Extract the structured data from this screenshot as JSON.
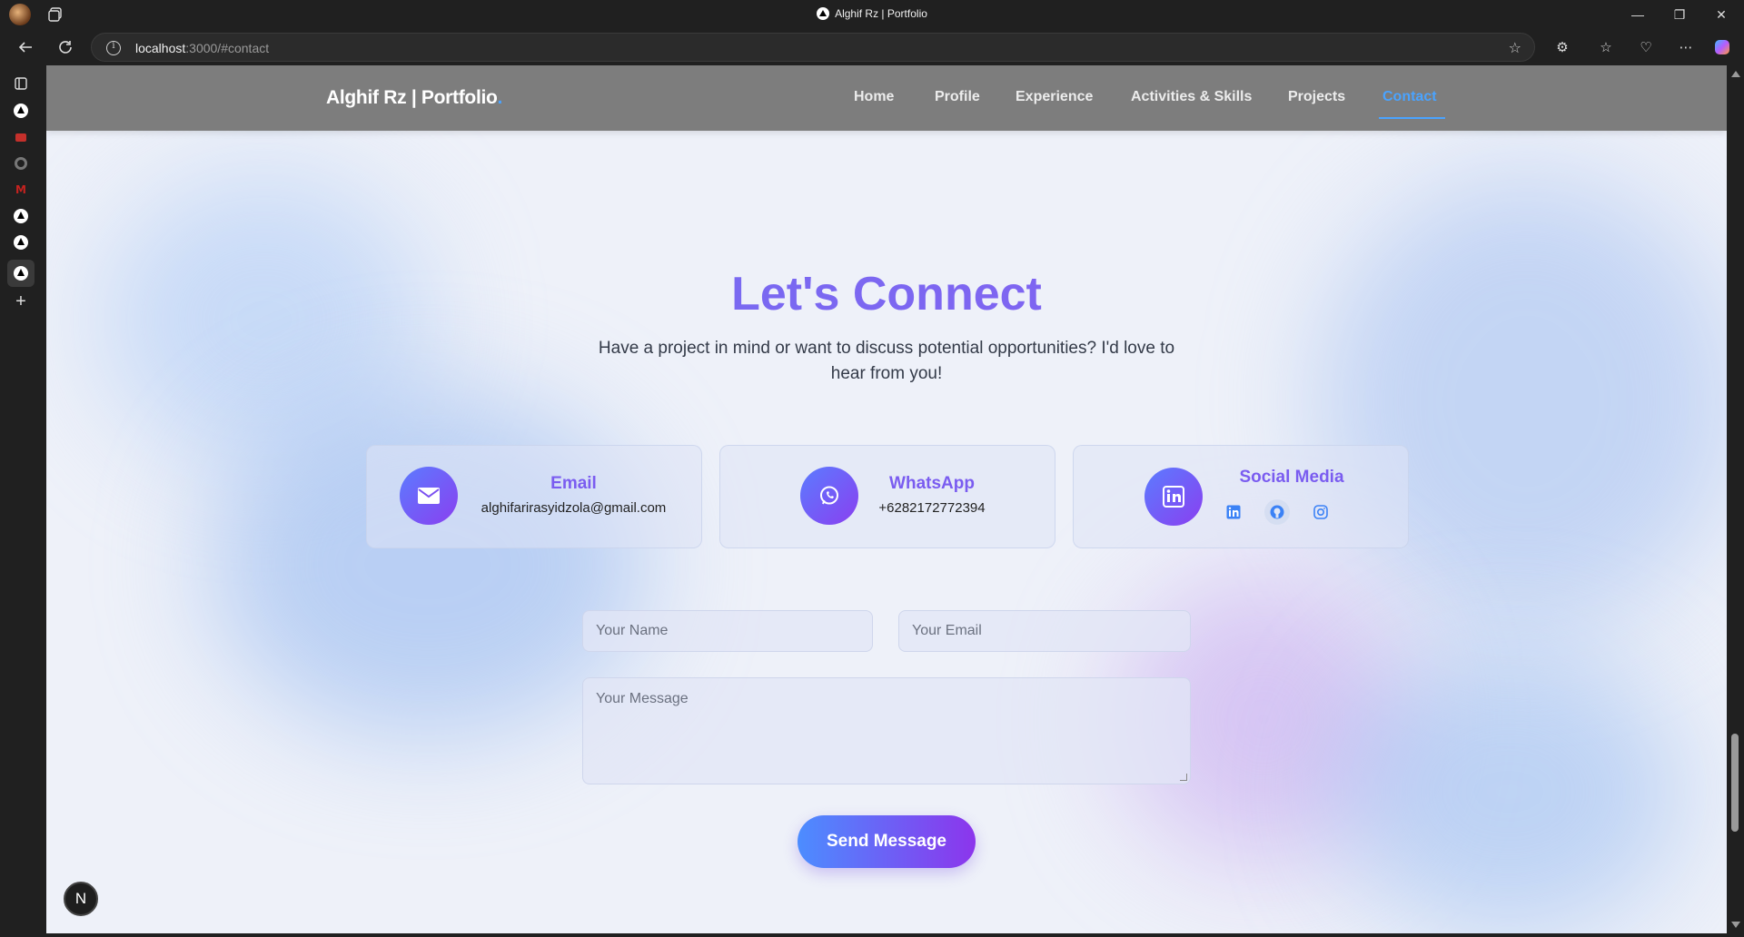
{
  "browser": {
    "tab_title": "Alghif Rz | Portfolio",
    "url_host": "localhost",
    "url_rest": ":3000/#contact",
    "window_controls": [
      "minimize-icon",
      "restore-icon",
      "close-icon"
    ]
  },
  "navbar": {
    "brand": "Alghif Rz | Portfolio",
    "brand_dot": ".",
    "links": [
      "Home",
      "Profile",
      "Experience",
      "Activities & Skills",
      "Projects",
      "Contact"
    ],
    "active": "Contact"
  },
  "contact": {
    "heading": "Let's Connect",
    "subtext": "Have a project in mind or want to discuss potential opportunities? I'd love to hear from you!",
    "cards": {
      "email_title": "Email",
      "email_value": "alghifarirasyidzola@gmail.com",
      "whatsapp_title": "WhatsApp",
      "whatsapp_value": "+6282172772394",
      "social_title": "Social Media"
    },
    "form": {
      "name_placeholder": "Your Name",
      "email_placeholder": "Your Email",
      "message_placeholder": "Your Message",
      "submit_label": "Send Message"
    }
  },
  "dev_badge": "N",
  "colors": {
    "accent": "#4aa3ff",
    "heading_gradient_start": "#6e72f2",
    "heading_gradient_end": "#8a5cf0",
    "button_gradient_start": "#4c8dff",
    "button_gradient_end": "#8c35ec"
  }
}
